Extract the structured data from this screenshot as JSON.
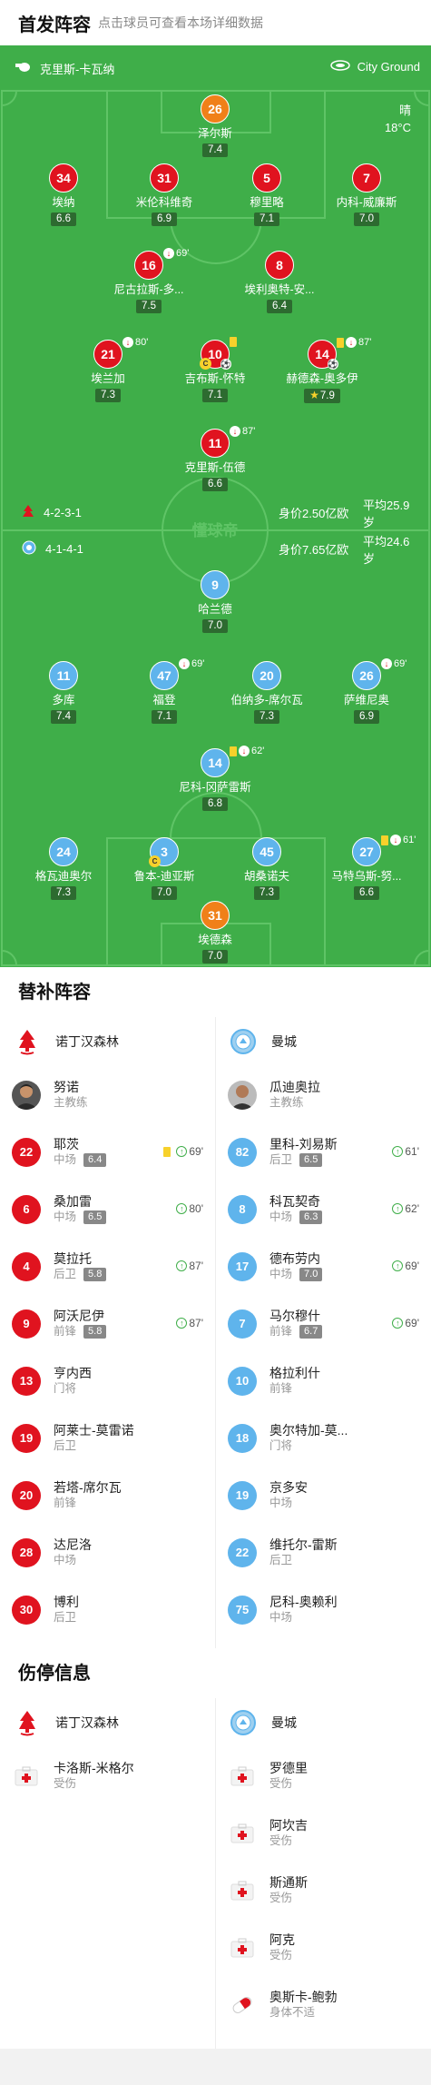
{
  "header": {
    "title": "首发阵容",
    "subtitle": "点击球员可查看本场详细数据"
  },
  "pitch_info": {
    "referee": "克里斯-卡瓦纳",
    "stadium": "City Ground",
    "weather": "晴",
    "temp": "18°C"
  },
  "home": {
    "formation": "4-2-3-1",
    "value": "身价2.50亿欧",
    "age": "平均25.9岁"
  },
  "away": {
    "formation": "4-1-4-1",
    "value": "身价7.65亿欧",
    "age": "平均24.6岁"
  },
  "home_players": [
    {
      "num": "26",
      "name": "泽尔斯",
      "rating": "7.4",
      "color": "orange"
    },
    {
      "num": "34",
      "name": "埃纳",
      "rating": "6.6",
      "color": "red"
    },
    {
      "num": "31",
      "name": "米伦科维奇",
      "rating": "6.9",
      "color": "red"
    },
    {
      "num": "5",
      "name": "穆里略",
      "rating": "7.1",
      "color": "red"
    },
    {
      "num": "7",
      "name": "内科-威廉斯",
      "rating": "7.0",
      "color": "red"
    },
    {
      "num": "16",
      "name": "尼古拉斯-多...",
      "rating": "7.5",
      "color": "red",
      "event": "69'"
    },
    {
      "num": "8",
      "name": "埃利奥特-安...",
      "rating": "6.4",
      "color": "red"
    },
    {
      "num": "21",
      "name": "埃兰加",
      "rating": "7.3",
      "color": "red",
      "event": "80'"
    },
    {
      "num": "10",
      "name": "吉布斯-怀特",
      "rating": "7.1",
      "color": "red"
    },
    {
      "num": "14",
      "name": "赫德森-奥多伊",
      "rating": "7.9",
      "color": "red",
      "event": "87'"
    },
    {
      "num": "11",
      "name": "克里斯-伍德",
      "rating": "6.6",
      "color": "red",
      "event": "87'"
    }
  ],
  "away_players": [
    {
      "num": "9",
      "name": "哈兰德",
      "rating": "7.0",
      "color": "blue"
    },
    {
      "num": "11",
      "name": "多库",
      "rating": "7.4",
      "color": "blue"
    },
    {
      "num": "47",
      "name": "福登",
      "rating": "7.1",
      "color": "blue",
      "event": "69'"
    },
    {
      "num": "20",
      "name": "伯纳多-席尔瓦",
      "rating": "7.3",
      "color": "blue"
    },
    {
      "num": "26",
      "name": "萨维尼奥",
      "rating": "6.9",
      "color": "blue",
      "event": "69'"
    },
    {
      "num": "14",
      "name": "尼科-冈萨雷斯",
      "rating": "6.8",
      "color": "blue",
      "event": "62'"
    },
    {
      "num": "24",
      "name": "格瓦迪奥尔",
      "rating": "7.3",
      "color": "blue"
    },
    {
      "num": "3",
      "name": "鲁本-迪亚斯",
      "rating": "7.0",
      "color": "blue"
    },
    {
      "num": "45",
      "name": "胡桑诺夫",
      "rating": "7.3",
      "color": "blue"
    },
    {
      "num": "27",
      "name": "马特乌斯-努...",
      "rating": "6.6",
      "color": "blue",
      "event": "61'"
    },
    {
      "num": "31",
      "name": "埃德森",
      "rating": "7.0",
      "color": "orange"
    }
  ],
  "subs_title": "替补阵容",
  "subs": {
    "home_team": "诺丁汉森林",
    "away_team": "曼城",
    "home_coach": {
      "name": "努诺",
      "role": "主教练"
    },
    "away_coach": {
      "name": "瓜迪奥拉",
      "role": "主教练"
    },
    "home": [
      {
        "num": "22",
        "name": "耶茨",
        "pos": "中场",
        "rating": "6.4",
        "time": "69'"
      },
      {
        "num": "6",
        "name": "桑加雷",
        "pos": "中场",
        "rating": "6.5",
        "time": "80'"
      },
      {
        "num": "4",
        "name": "莫拉托",
        "pos": "后卫",
        "rating": "5.8",
        "time": "87'"
      },
      {
        "num": "9",
        "name": "阿沃尼伊",
        "pos": "前锋",
        "rating": "5.8",
        "time": "87'"
      },
      {
        "num": "13",
        "name": "亨内西",
        "pos": "门将"
      },
      {
        "num": "19",
        "name": "阿莱士-莫雷诺",
        "pos": "后卫"
      },
      {
        "num": "20",
        "name": "若塔-席尔瓦",
        "pos": "前锋"
      },
      {
        "num": "28",
        "name": "达尼洛",
        "pos": "中场"
      },
      {
        "num": "30",
        "name": "博利",
        "pos": "后卫"
      }
    ],
    "away": [
      {
        "num": "82",
        "name": "里科-刘易斯",
        "pos": "后卫",
        "rating": "6.5",
        "time": "61'"
      },
      {
        "num": "8",
        "name": "科瓦契奇",
        "pos": "中场",
        "rating": "6.3",
        "time": "62'"
      },
      {
        "num": "17",
        "name": "德布劳内",
        "pos": "中场",
        "rating": "7.0",
        "time": "69'"
      },
      {
        "num": "7",
        "name": "马尔穆什",
        "pos": "前锋",
        "rating": "6.7",
        "time": "69'"
      },
      {
        "num": "10",
        "name": "格拉利什",
        "pos": "前锋"
      },
      {
        "num": "18",
        "name": "奥尔特加-莫...",
        "pos": "门将"
      },
      {
        "num": "19",
        "name": "京多安",
        "pos": "中场"
      },
      {
        "num": "22",
        "name": "维托尔-雷斯",
        "pos": "后卫"
      },
      {
        "num": "75",
        "name": "尼科-奥赖利",
        "pos": "中场"
      }
    ]
  },
  "injury_title": "伤停信息",
  "injuries": {
    "home": [
      {
        "name": "卡洛斯-米格尔",
        "status": "受伤"
      }
    ],
    "away": [
      {
        "name": "罗德里",
        "status": "受伤"
      },
      {
        "name": "阿坎吉",
        "status": "受伤"
      },
      {
        "name": "斯通斯",
        "status": "受伤"
      },
      {
        "name": "阿克",
        "status": "受伤"
      },
      {
        "name": "奥斯卡-鲍勃",
        "status": "身体不适"
      }
    ]
  },
  "colors": {
    "pitch": "#3fae49",
    "home": "#e0131f",
    "away": "#5fb4ec",
    "keeper": "#f08019"
  }
}
